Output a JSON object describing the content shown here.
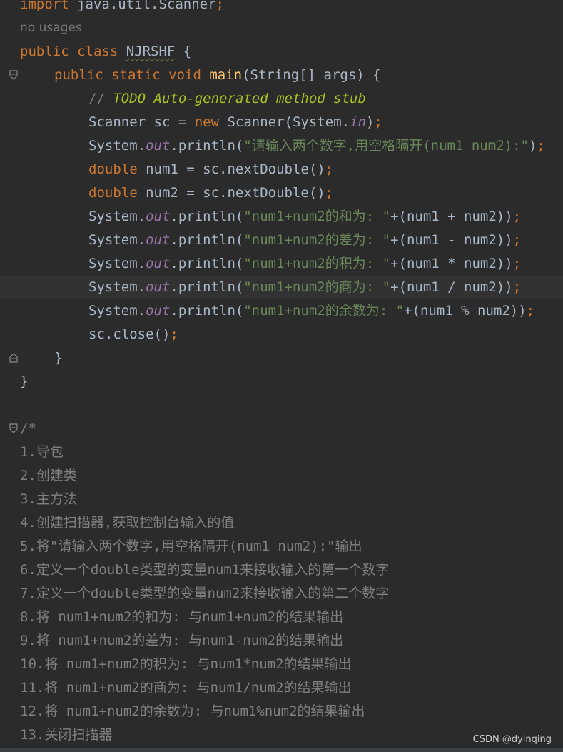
{
  "code": {
    "import_kw": "import",
    "import_path": " java.util.Scanner",
    "usage_hint": "no usages",
    "class_decl_prefix": "public class ",
    "class_name": "NJRSHF",
    "class_open": " {",
    "main_mods": "public static void ",
    "main_name": "main",
    "main_params": "(String[] args) {",
    "todo_slashes": "// ",
    "todo_text": "TODO Auto-generated method stub",
    "scanner_prefix": "Scanner sc = ",
    "scanner_new": "new",
    "scanner_mid": " Scanner(System.",
    "scanner_in": "in",
    "scanner_end": ")",
    "print_prefix": "System.",
    "print_out": "out",
    "print_method": ".println(",
    "prompt_str": "\"请输入两个数字,用空格隔开(num1 num2):\"",
    "close_paren": ")",
    "double_kw": "double",
    "num1_decl": " num1 = sc.nextDouble()",
    "num2_decl": " num2 = sc.nextDouble()",
    "sum_str": "\"num1+num2的和为: \"",
    "sum_expr": "+(num1 + num2))",
    "diff_str": "\"num1+num2的差为: \"",
    "diff_expr": "+(num1 - num2))",
    "prod_str": "\"num1+num2的积为: \"",
    "prod_expr": "+(num1 * num2))",
    "quot_str": "\"num1+num2的商为: \"",
    "quot_expr": "+(num1 / num2))",
    "rem_str": "\"num1+num2的余数为: \"",
    "rem_expr": "+(num1 % num2))",
    "close_stmt": "sc.close()",
    "semicolon": ";",
    "brace_close_method": "}",
    "brace_close_class": "}"
  },
  "comment": {
    "open": "/*",
    "steps": [
      "1.导包",
      "2.创建类",
      "3.主方法",
      "4.创建扫描器,获取控制台输入的值",
      "5.将\"请输入两个数字,用空格隔开(num1 num2):\"输出",
      "6.定义一个double类型的变量num1来接收输入的第一个数字",
      "7.定义一个double类型的变量num2来接收输入的第二个数字",
      "8.将 num1+num2的和为: 与num1+num2的结果输出",
      "9.将 num1+num2的差为: 与num1-num2的结果输出",
      "10.将 num1+num2的积为: 与num1*num2的结果输出",
      "11.将 num1+num2的商为: 与num1/num2的结果输出",
      "12.将 num1+num2的余数为: 与num1%num2的结果输出",
      "13.关闭扫描器"
    ]
  },
  "watermark": "CSDN @dyinqing",
  "colors": {
    "background": "#2b2b2b",
    "keyword": "#cc7832",
    "string": "#6a8759",
    "function": "#ffc66d",
    "static_field": "#9876aa",
    "todo": "#a8c023",
    "comment": "#808080",
    "text": "#a9b7c6"
  },
  "icons": [
    "fold-open-icon",
    "fold-close-icon"
  ]
}
